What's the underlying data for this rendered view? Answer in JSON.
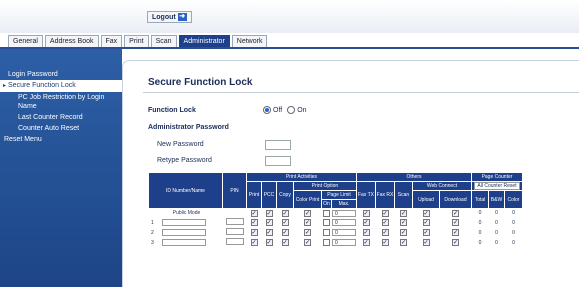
{
  "header": {
    "logout_label": "Logout"
  },
  "tabs": [
    {
      "label": "General"
    },
    {
      "label": "Address Book"
    },
    {
      "label": "Fax"
    },
    {
      "label": "Print"
    },
    {
      "label": "Scan"
    },
    {
      "label": "Administrator",
      "active": true
    },
    {
      "label": "Network"
    }
  ],
  "sidebar": {
    "items": [
      {
        "label": "Login Password"
      },
      {
        "label": "Secure Function Lock",
        "active": true
      },
      {
        "label": "PC Job Restriction by Login Name"
      },
      {
        "label": "Last Counter Record"
      },
      {
        "label": "Counter Auto Reset"
      },
      {
        "label": "Reset Menu"
      }
    ]
  },
  "main": {
    "title": "Secure Function Lock",
    "function_lock_label": "Function Lock",
    "off_label": "Off",
    "on_label": "On",
    "selected": "Off",
    "admin_password_label": "Administrator Password",
    "new_password_label": "New Password",
    "retype_password_label": "Retype Password"
  },
  "table": {
    "headers": {
      "id": "ID Number/Name",
      "pin": "PIN",
      "print_activities": "Print Activities",
      "print_option": "Print Option",
      "page_limit": "Page Limit",
      "print": "Print",
      "pcc": "PCC",
      "copy": "Copy",
      "color_print": "Color Print",
      "on": "On",
      "max": "Max.",
      "others": "Others",
      "web_connect": "Web Connect",
      "fax_tx": "Fax TX",
      "fax_rx": "Fax RX",
      "scan": "Scan",
      "upload": "Upload",
      "download": "Download",
      "page_counter": "Page Counter",
      "all_counter_reset": "All Counter Reset",
      "total": "Total",
      "bw": "B&W",
      "color": "Color"
    },
    "rows": [
      {
        "id": "Public Mode",
        "max": "0",
        "total": "0",
        "bw": "0",
        "color": "0"
      },
      {
        "id": "1",
        "max": "0",
        "total": "0",
        "bw": "0",
        "color": "0"
      },
      {
        "id": "2",
        "max": "0",
        "total": "0",
        "bw": "0",
        "color": "0"
      },
      {
        "id": "3",
        "max": "0",
        "total": "0",
        "bw": "0",
        "color": "0"
      }
    ]
  }
}
